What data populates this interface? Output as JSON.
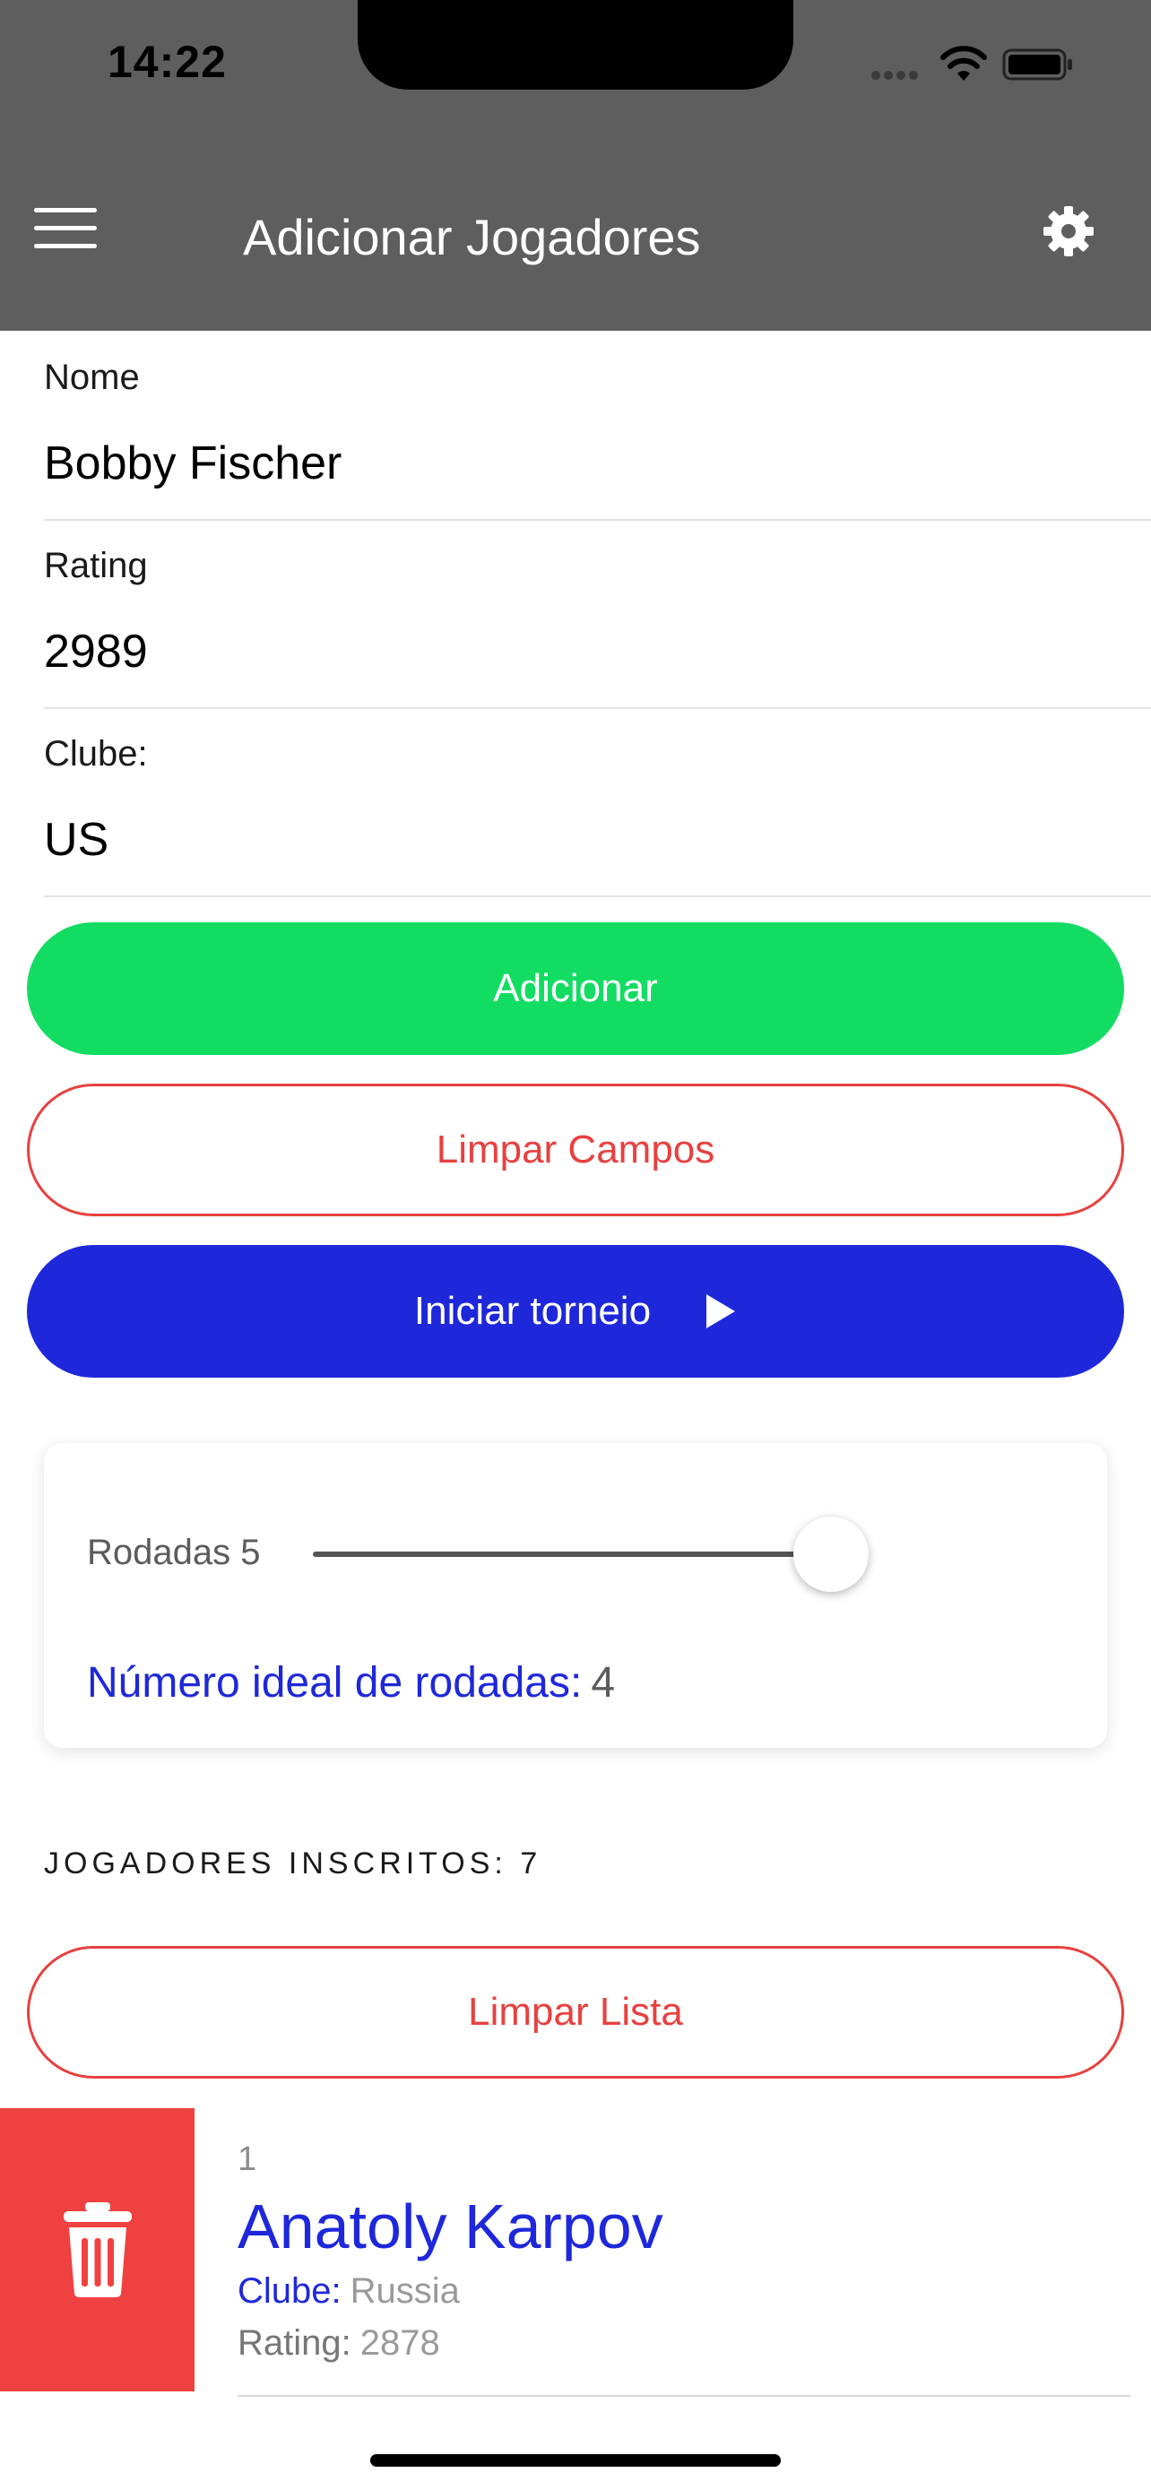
{
  "status_bar": {
    "time": "14:22"
  },
  "header": {
    "title": "Adicionar Jogadores",
    "menu_icon": "hamburger-menu-icon",
    "settings_icon": "gear-icon",
    "background_color": "#5e5e5e"
  },
  "form": {
    "name": {
      "label": "Nome",
      "value": "Bobby Fischer"
    },
    "rating": {
      "label": "Rating",
      "value": "2989"
    },
    "club": {
      "label": "Clube:",
      "value": "US"
    }
  },
  "buttons": {
    "add": {
      "label": "Adicionar",
      "color": "#13dc62"
    },
    "clear_fields": {
      "label": "Limpar Campos",
      "color": "#e8403f"
    },
    "start_tournament": {
      "label": "Iniciar torneio",
      "color": "#1e28da",
      "icon": "play-icon"
    }
  },
  "rounds": {
    "label": "Rodadas 5",
    "slider_value": 5,
    "ideal_label": "Número ideal de rodadas:",
    "ideal_value": "4"
  },
  "players_section": {
    "header": "JOGADORES INSCRITOS: 7",
    "clear_list_label": "Limpar Lista",
    "delete_icon": "trash-icon",
    "players": [
      {
        "index": "1",
        "name": "Anatoly Karpov",
        "club_label": "Clube:",
        "club": "Russia",
        "rating_label": "Rating:",
        "rating": "2878"
      }
    ]
  }
}
